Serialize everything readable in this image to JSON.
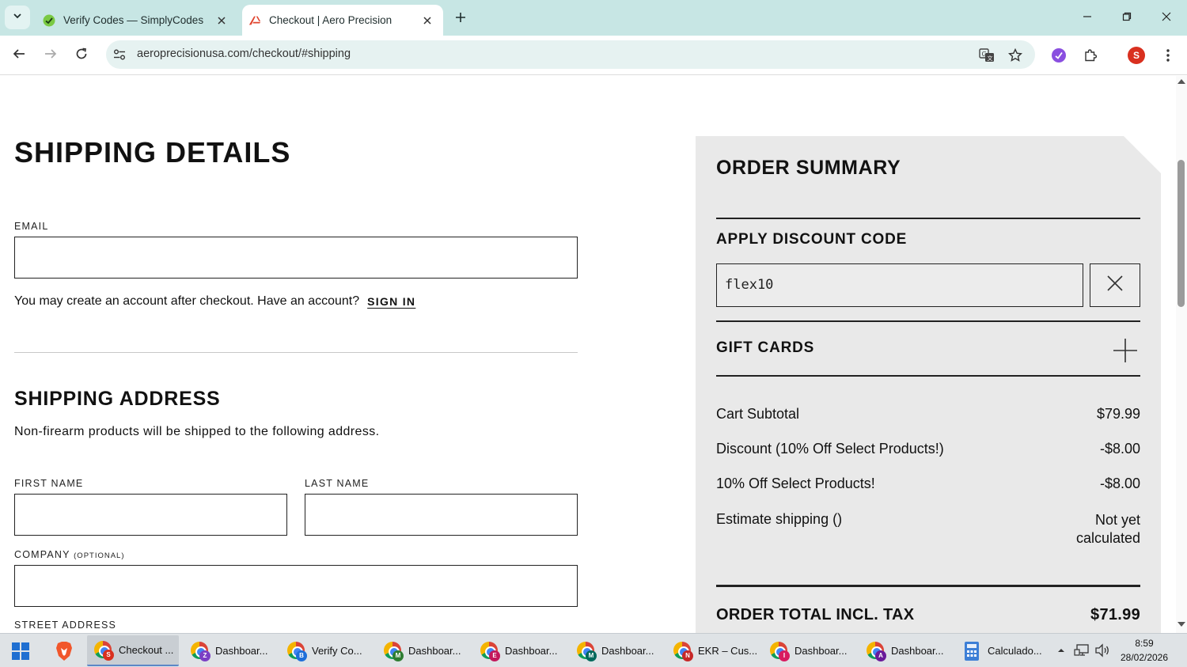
{
  "browser": {
    "tabs": [
      {
        "title": "Verify Codes — SimplyCodes",
        "active": false
      },
      {
        "title": "Checkout | Aero Precision",
        "active": true
      }
    ],
    "url": "aeroprecisionusa.com/checkout/#shipping",
    "profile_initial": "S"
  },
  "shipping": {
    "heading": "SHIPPING DETAILS",
    "email_label": "EMAIL",
    "email_value": "",
    "account_note": "You may create an account after checkout. Have an account?",
    "sign_in": "SIGN IN",
    "address_heading": "SHIPPING ADDRESS",
    "address_note": "Non-firearm products will be shipped to the following address.",
    "first_name_label": "FIRST NAME",
    "last_name_label": "LAST NAME",
    "company_label": "COMPANY",
    "company_optional": "(OPTIONAL)",
    "street_label": "STREET ADDRESS"
  },
  "summary": {
    "title": "ORDER SUMMARY",
    "discount_heading": "APPLY DISCOUNT CODE",
    "discount_code": "flex10",
    "gift_cards": "GIFT CARDS",
    "rows": [
      {
        "label": "Cart Subtotal",
        "value": "$79.99"
      },
      {
        "label": "Discount (10% Off Select Products!)",
        "value": "-$8.00"
      },
      {
        "label": "10% Off Select Products!",
        "value": "-$8.00"
      },
      {
        "label": "Estimate shipping ()",
        "value": "Not yet calculated"
      }
    ],
    "total_label": "ORDER TOTAL INCL. TAX",
    "total_value": "$71.99"
  },
  "taskbar": {
    "items": [
      {
        "label": "Checkout ...",
        "badge": "S",
        "badge_color": "#d9301f",
        "active": true
      },
      {
        "label": "Dashboar...",
        "badge": "Z",
        "badge_color": "#7b3fc4",
        "active": false
      },
      {
        "label": "Verify Co...",
        "badge": "B",
        "badge_color": "#1e6fd9",
        "active": false
      },
      {
        "label": "Dashboar...",
        "badge": "M",
        "badge_color": "#2e7d32",
        "active": false
      },
      {
        "label": "Dashboar...",
        "badge": "E",
        "badge_color": "#c2185b",
        "active": false
      },
      {
        "label": "Dashboar...",
        "badge": "M",
        "badge_color": "#00695c",
        "active": false
      },
      {
        "label": "EKR – Cus...",
        "badge": "N",
        "badge_color": "#c62828",
        "active": false
      },
      {
        "label": "Dashboar...",
        "badge": "I",
        "badge_color": "#d81b60",
        "active": false
      },
      {
        "label": "Dashboar...",
        "badge": "A",
        "badge_color": "#6a1b9a",
        "active": false
      },
      {
        "label": "Calculado...",
        "badge": "",
        "badge_color": "",
        "active": false
      }
    ],
    "time": "8:59",
    "date": "28/02/2026"
  },
  "colors": {
    "tabstrip": "#c7e6e4",
    "summary_bg": "#e9e9e9",
    "accent_red": "#d9301f"
  }
}
